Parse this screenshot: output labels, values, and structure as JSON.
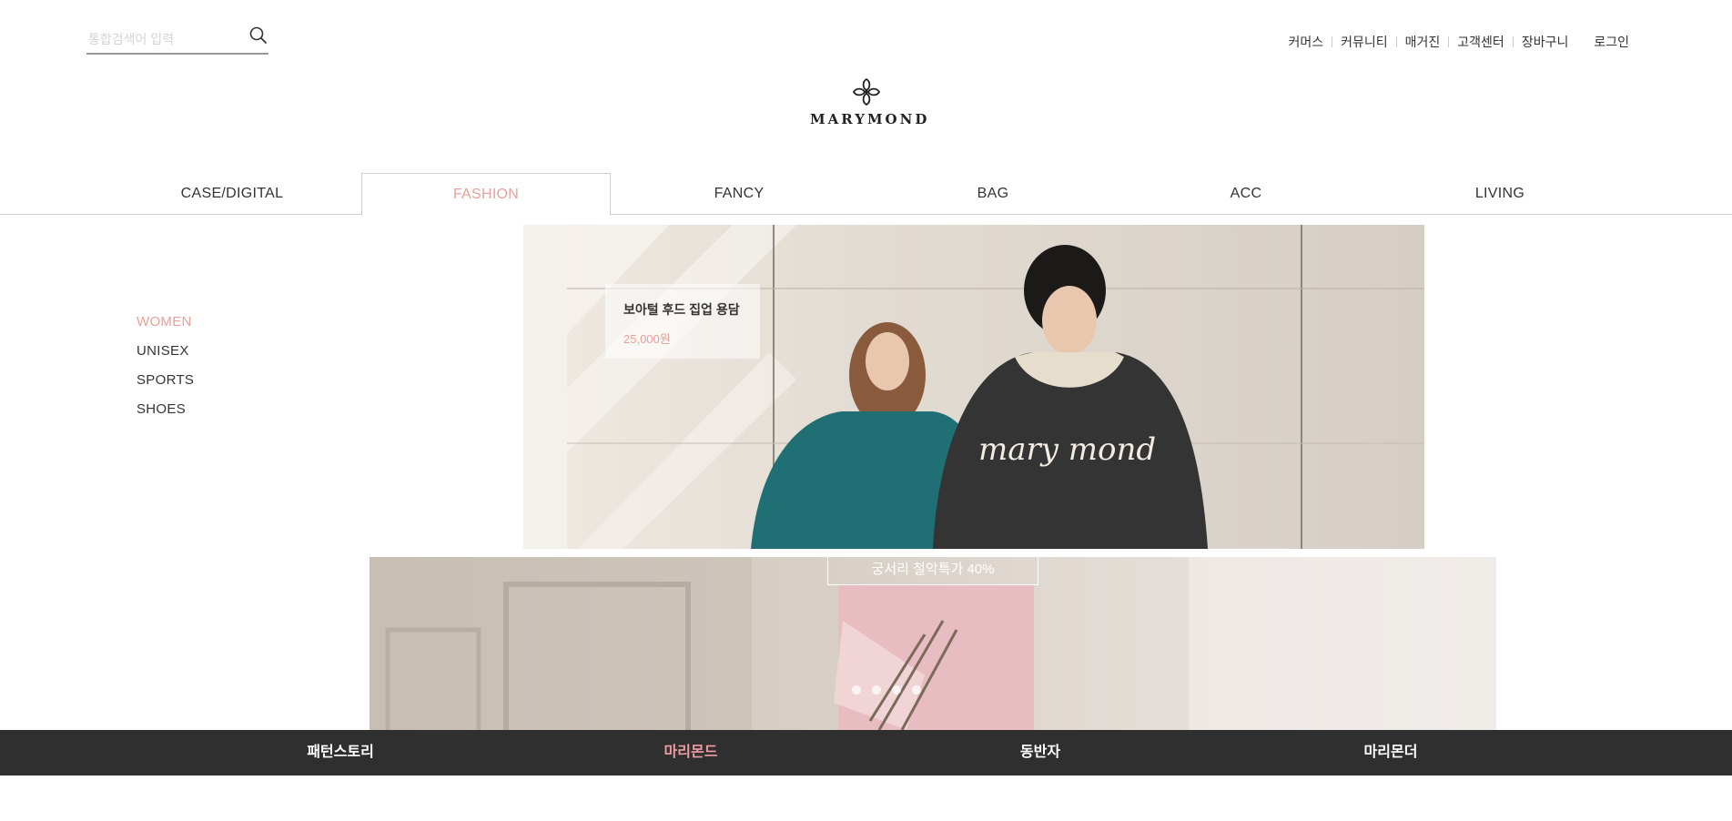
{
  "search": {
    "placeholder": "통합검색어 입력"
  },
  "util_menu": {
    "items": [
      "커머스",
      "커뮤니티",
      "매거진",
      "고객센터",
      "장바구니"
    ],
    "login": "로그인"
  },
  "logo": {
    "text": "MARYMOND"
  },
  "gnb": {
    "tabs": [
      "CASE/DIGITAL",
      "FASHION",
      "FANCY",
      "BAG",
      "ACC",
      "LIVING"
    ],
    "active": "FASHION"
  },
  "side_menu": {
    "items": [
      "WOMEN",
      "UNISEX",
      "SPORTS",
      "SHOES"
    ],
    "active": "WOMEN"
  },
  "hero": {
    "product_name": "보아털 후드 집업 용담",
    "product_price": "25,000원"
  },
  "promo": {
    "label": "궁서리 철악특가 40%"
  },
  "slider": {
    "dot_count": 4
  },
  "brand_bar": {
    "items": [
      "패턴스토리",
      "마리몬드",
      "동반자",
      "마리몬더"
    ],
    "active": "마리몬드"
  },
  "colors": {
    "accent": "#e8a09a",
    "brand_bar_bg": "#2f2f2f",
    "brand_bar_active": "#f09ca5"
  }
}
